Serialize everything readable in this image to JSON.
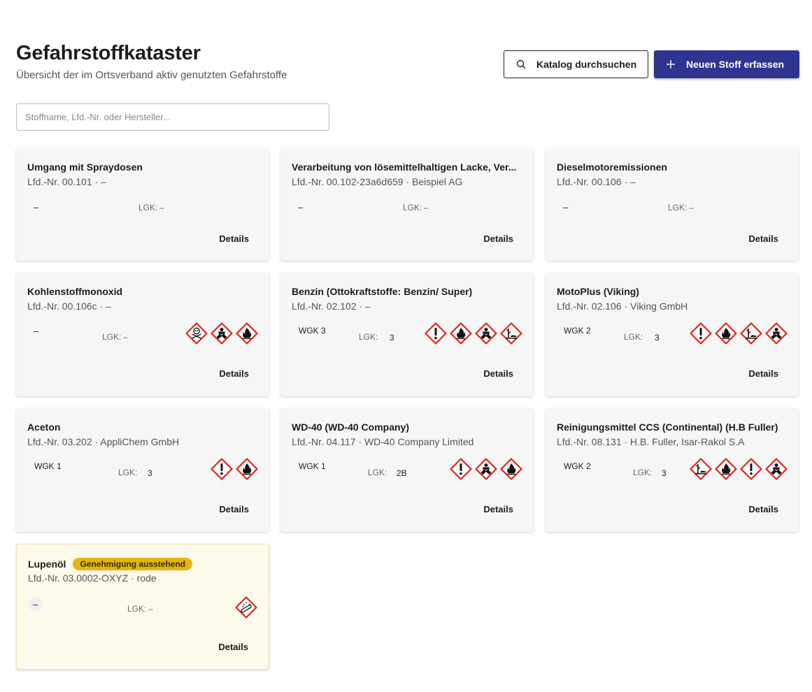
{
  "header": {
    "title": "Gefahrstoffkataster",
    "subtitle": "Übersicht der im Ortsverband aktiv genutzten Gefahrstoffe"
  },
  "actions": {
    "catalog_label": "Katalog durchsuchen",
    "new_label": "Neuen Stoff erfassen"
  },
  "search": {
    "placeholder": "Stoffname, Lfd.-Nr. oder Hersteller...",
    "value": ""
  },
  "lgk_label": "LGK:",
  "details_label": "Details",
  "colors": {
    "primary": "#2f3491",
    "ghs_red": "#e2241b",
    "badge": "#e6b40f"
  },
  "cards": [
    {
      "title": "Umgang mit Spraydosen",
      "meta": "Lfd.-Nr. 00.101 · –",
      "wgk": "–",
      "lgk": "–",
      "pictograms": []
    },
    {
      "title": "Verarbeitung von lösemittelhaltigen Lacke, Ver...",
      "meta": "Lfd.-Nr. 00.102-23a6d659 · Beispiel AG",
      "wgk": "–",
      "lgk": "–",
      "pictograms": []
    },
    {
      "title": "Dieselmotoremissionen",
      "meta": "Lfd.-Nr. 00.106 · –",
      "wgk": "–",
      "lgk": "–",
      "pictograms": []
    },
    {
      "title": "Kohlenstoffmonoxid",
      "meta": "Lfd.-Nr. 00.106c · –",
      "wgk": "–",
      "lgk": "–",
      "pictograms": [
        "skull-icon",
        "health-hazard-icon",
        "flame-icon"
      ]
    },
    {
      "title": "Benzin (Ottokraftstoffe: Benzin/ Super)",
      "meta": "Lfd.-Nr. 02.102 · –",
      "wgk": "WGK 3",
      "lgk": "3",
      "pictograms": [
        "exclamation-icon",
        "flame-icon",
        "health-hazard-icon",
        "environment-icon"
      ]
    },
    {
      "title": "MotoPlus (Viking)",
      "meta": "Lfd.-Nr. 02.106 · Viking GmbH",
      "wgk": "WGK 2",
      "lgk": "3",
      "pictograms": [
        "exclamation-icon",
        "flame-icon",
        "environment-icon",
        "health-hazard-icon"
      ]
    },
    {
      "title": "Aceton",
      "meta": "Lfd.-Nr. 03.202 · AppliChem GmbH",
      "wgk": "WGK 1",
      "lgk": "3",
      "pictograms": [
        "exclamation-icon",
        "flame-icon"
      ]
    },
    {
      "title": "WD-40 (WD-40 Company)",
      "meta": "Lfd.-Nr. 04.117 · WD-40 Company Limited",
      "wgk": "WGK 1",
      "lgk": "2B",
      "pictograms": [
        "exclamation-icon",
        "health-hazard-icon",
        "flame-icon"
      ]
    },
    {
      "title": "Reinigungsmittel CCS (Continental) (H.B Fuller)",
      "meta": "Lfd.-Nr. 08.131 · H.B. Fuller, Isar-Rakol S.A",
      "wgk": "WGK 2",
      "lgk": "3",
      "pictograms": [
        "environment-icon",
        "flame-icon",
        "exclamation-icon",
        "health-hazard-icon"
      ]
    },
    {
      "title": "Lupenöl",
      "badge": "Genehmigung ausstehend",
      "meta": "Lfd.-Nr. 03.0002-OXYZ · rode",
      "wgk": "–",
      "lgk": "–",
      "pictograms": [
        "gas-cylinder-icon"
      ]
    }
  ]
}
